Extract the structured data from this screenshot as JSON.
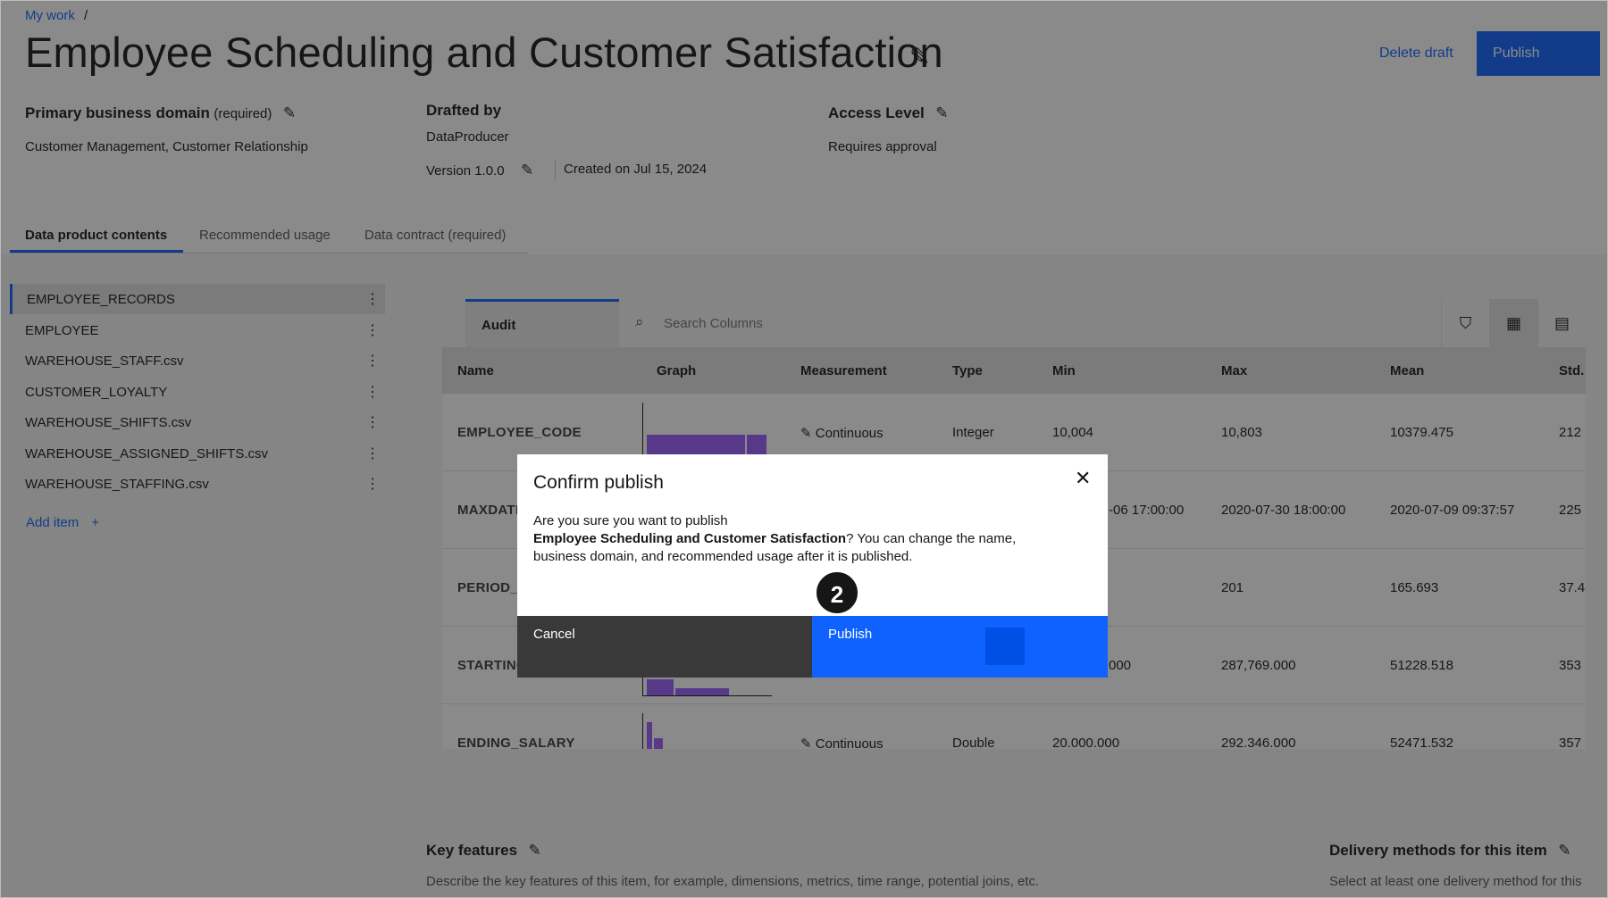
{
  "breadcrumb": {
    "item": "My work",
    "separator": "/"
  },
  "page": {
    "title": "Employee Scheduling and Customer Satisfaction"
  },
  "actions": {
    "delete_draft": "Delete draft",
    "publish": "Publish"
  },
  "meta": {
    "domain_label": "Primary business domain",
    "domain_required": "(required)",
    "domain_value": "Customer Management, Customer Relationship",
    "drafted_label": "Drafted by",
    "drafted_value": "DataProducer",
    "version": "Version 1.0.0",
    "created": "Created on Jul 15, 2024",
    "access_label": "Access Level",
    "access_value": "Requires approval"
  },
  "tabs": [
    {
      "label": "Data product contents"
    },
    {
      "label": "Recommended usage"
    },
    {
      "label": "Data contract (required)"
    }
  ],
  "assets": [
    {
      "label": "EMPLOYEE_RECORDS"
    },
    {
      "label": "EMPLOYEE"
    },
    {
      "label": "WAREHOUSE_STAFF.csv"
    },
    {
      "label": "CUSTOMER_LOYALTY"
    },
    {
      "label": "WAREHOUSE_SHIFTS.csv"
    },
    {
      "label": "WAREHOUSE_ASSIGNED_SHIFTS.csv"
    },
    {
      "label": "WAREHOUSE_STAFFING.csv"
    }
  ],
  "add_item": "Add item",
  "table": {
    "tab": "Audit",
    "search_placeholder": "Search Columns",
    "columns": [
      "Name",
      "Graph",
      "Measurement",
      "Type",
      "Min",
      "Max",
      "Mean",
      "Std."
    ],
    "rows": [
      {
        "name": "EMPLOYEE_CODE",
        "measurement": "Continuous",
        "type": "Integer",
        "min": "10,004",
        "max": "10,803",
        "mean": "10379.475",
        "std": "212"
      },
      {
        "name": "MAXDATE",
        "measurement": "",
        "type": "",
        "min": "-06 17:00:00",
        "max": "2020-07-30 18:00:00",
        "mean": "2020-07-09 09:37:57",
        "std": "225"
      },
      {
        "name": "PERIOD_T",
        "measurement": "",
        "type": "",
        "min": "",
        "max": "201",
        "mean": "165.693",
        "std": "37.4"
      },
      {
        "name": "STARTING",
        "measurement": "",
        "type": "",
        "min": "000",
        "max": "287,769.000",
        "mean": "51228.518",
        "std": "353"
      },
      {
        "name": "ENDING_SALARY",
        "measurement": "Continuous",
        "type": "Double",
        "min": "20.000.000",
        "max": "292.346.000",
        "mean": "52471.532",
        "std": "357"
      }
    ]
  },
  "sections": {
    "key_features_title": "Key features",
    "key_features_desc": "Describe the key features of this item, for example, dimensions, metrics, time range, potential joins, etc.",
    "delivery_title": "Delivery methods for this item",
    "delivery_desc": "Select at least one delivery method for this"
  },
  "modal": {
    "title": "Confirm publish",
    "body_prefix": "Are you sure you want to publish",
    "body_bold": "Employee Scheduling and Customer Satisfaction",
    "body_suffix": "? You can change the name, business domain, and recommended usage after it is published.",
    "cancel": "Cancel",
    "publish": "Publish",
    "step": "2"
  },
  "colors": {
    "primary": "#0f62fe",
    "graph": "#8a3ffc",
    "cancel_bg": "#393939"
  },
  "icons": [
    "edit-icon",
    "search-icon",
    "filter-icon",
    "grid-view-icon",
    "list-view-icon",
    "overflow-menu-icon",
    "close-icon",
    "add-icon",
    "ruler-icon"
  ]
}
